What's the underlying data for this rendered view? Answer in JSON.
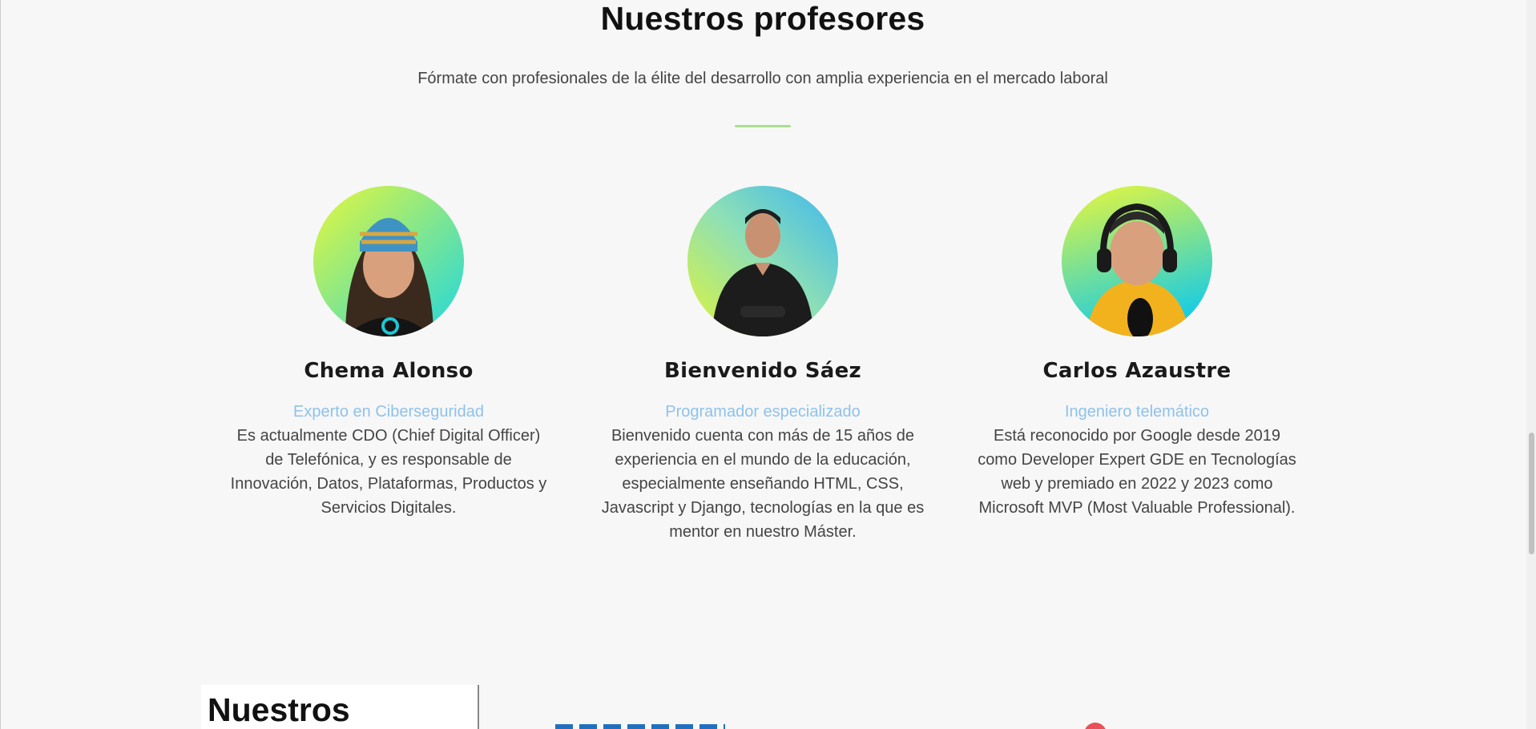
{
  "section": {
    "title": "Nuestros profesores",
    "subtitle": "Fórmate con profesionales de la élite del desarrollo con amplia experiencia en el mercado laboral"
  },
  "teachers": [
    {
      "name": "Chema Alonso",
      "role": "Experto en Ciberseguridad",
      "bio": "Es actualmente CDO (Chief Digital Officer) de Telefónica, y es responsable de Innovación, Datos, Plataformas, Productos y Servicios Digitales."
    },
    {
      "name": "Bienvenido Sáez",
      "role": "Programador especializado",
      "bio": "Bienvenido cuenta con más de 15 años de experiencia en el mundo de la educación, especialmente enseñando HTML, CSS, Javascript y Django, tecnologías en la que es mentor en nuestro Máster."
    },
    {
      "name": "Carlos Azaustre",
      "role": "Ingeniero telemático",
      "bio": "Está reconocido por Google desde 2019 como Developer Expert GDE en Tecnologías web y premiado en 2022 y 2023 como Microsoft MVP (Most Valuable Professional)."
    }
  ],
  "next_section": {
    "title": "Nuestros"
  },
  "colors": {
    "accent_divider": "#a9df8f",
    "role_text": "#8ec2ec"
  }
}
